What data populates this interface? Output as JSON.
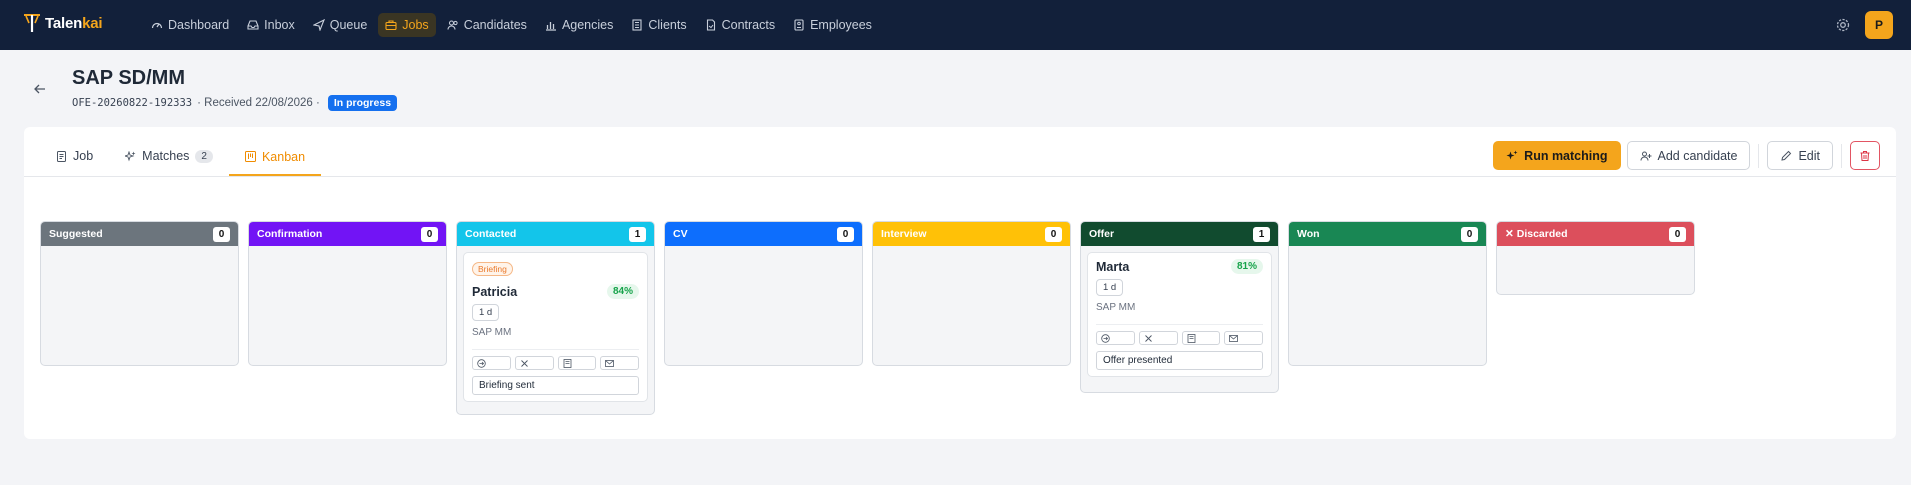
{
  "brand": {
    "name_main": "Talen",
    "name_accent": "kai"
  },
  "nav": {
    "items": [
      {
        "label": "Dashboard",
        "icon": "dashboard-icon"
      },
      {
        "label": "Inbox",
        "icon": "inbox-icon"
      },
      {
        "label": "Queue",
        "icon": "queue-icon"
      },
      {
        "label": "Jobs",
        "icon": "briefcase-icon",
        "active": true
      },
      {
        "label": "Candidates",
        "icon": "users-icon"
      },
      {
        "label": "Agencies",
        "icon": "chart-icon"
      },
      {
        "label": "Clients",
        "icon": "building-icon"
      },
      {
        "label": "Contracts",
        "icon": "file-icon"
      },
      {
        "label": "Employees",
        "icon": "id-card-icon"
      }
    ],
    "user_initial": "P"
  },
  "header": {
    "title": "SAP SD/MM",
    "code": "OFE-20260822-192333",
    "received": "· Received 22/08/2026 ·",
    "status": "In progress"
  },
  "tabs": [
    {
      "label": "Job"
    },
    {
      "label": "Matches",
      "count": "2"
    },
    {
      "label": "Kanban",
      "active": true
    }
  ],
  "actions": {
    "run_matching": "Run matching",
    "add_candidate": "Add candidate",
    "edit": "Edit"
  },
  "columns": [
    {
      "title": "Suggested",
      "count": "0",
      "color": "#6c757d"
    },
    {
      "title": "Confirmation",
      "count": "0",
      "color": "#7214f5"
    },
    {
      "title": "Contacted",
      "count": "1",
      "color": "#13c5ea",
      "card": {
        "tag": "Briefing",
        "name": "Patricia",
        "score": "84%",
        "days": "1 d",
        "role": "SAP MM",
        "note": "Briefing sent"
      }
    },
    {
      "title": "CV",
      "count": "0",
      "color": "#0d6efd"
    },
    {
      "title": "Interview",
      "count": "0",
      "color": "#ffc107"
    },
    {
      "title": "Offer",
      "count": "1",
      "color": "#114b2f",
      "card": {
        "name": "Marta",
        "score": "81%",
        "days": "1 d",
        "role": "SAP MM",
        "note": "Offer presented"
      }
    },
    {
      "title": "Won",
      "count": "0",
      "color": "#198754"
    },
    {
      "title": "Discarded",
      "count": "0",
      "color": "#dc4f5c",
      "prefix": "✕"
    }
  ]
}
